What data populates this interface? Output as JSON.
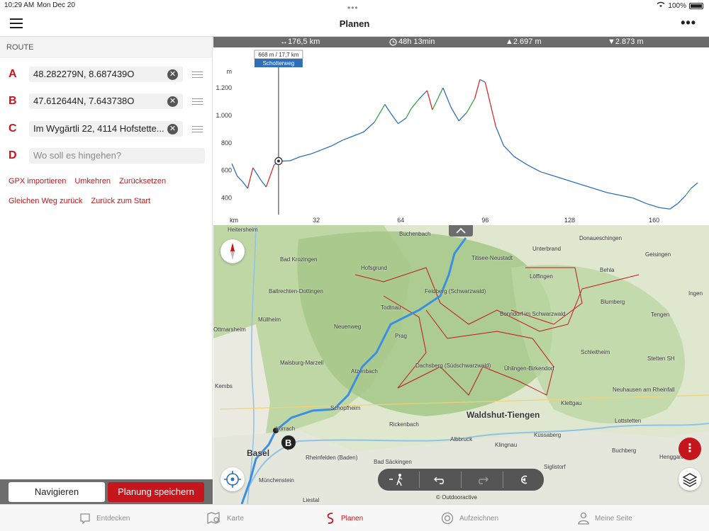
{
  "status": {
    "time": "10:29 AM",
    "date": "Mon Dec 20",
    "battery": "100%"
  },
  "header": {
    "title": "Planen"
  },
  "route": {
    "header": "ROUTE",
    "waypoints": [
      {
        "letter": "A",
        "value": "48.282279N, 8.687439O"
      },
      {
        "letter": "B",
        "value": "47.612644N, 7.643738O"
      },
      {
        "letter": "C",
        "value": "Im Wygärtli 22, 4114 Hofstette..."
      },
      {
        "letter": "D",
        "placeholder": "Wo soll es hingehen?"
      }
    ],
    "actions_row1": [
      "GPX importieren",
      "Umkehren",
      "Zurücksetzen"
    ],
    "actions_row2": [
      "Gleichen Weg zurück",
      "Zurück zum Start"
    ]
  },
  "buttons": {
    "navigate": "Navigieren",
    "save": "Planung speichern"
  },
  "stats": {
    "distance": "↔176,5 km",
    "duration": "48h 13min",
    "ascent": "▲2.697 m",
    "descent": "▼2.873 m"
  },
  "chart_data": {
    "type": "line",
    "title": "",
    "xlabel": "km",
    "ylabel": "m",
    "xlim": [
      0,
      176.5
    ],
    "ylim": [
      280,
      1380
    ],
    "x_ticks": [
      32,
      64,
      96,
      128,
      160
    ],
    "y_ticks": [
      400,
      600,
      800,
      "1.000",
      "1.200"
    ],
    "y_tick_values": [
      400,
      600,
      800,
      1000,
      1200
    ],
    "cursor": {
      "km": 17.7,
      "elevation": 668,
      "label": "668 m / 17,7 km",
      "surface": "Schotterweg"
    },
    "points": [
      [
        0,
        650
      ],
      [
        2,
        560
      ],
      [
        4,
        520
      ],
      [
        6,
        470
      ],
      [
        8,
        620
      ],
      [
        11,
        530
      ],
      [
        13,
        480
      ],
      [
        16,
        640
      ],
      [
        18,
        668
      ],
      [
        22,
        670
      ],
      [
        26,
        700
      ],
      [
        30,
        720
      ],
      [
        34,
        750
      ],
      [
        38,
        780
      ],
      [
        42,
        820
      ],
      [
        46,
        850
      ],
      [
        50,
        880
      ],
      [
        54,
        950
      ],
      [
        58,
        1080
      ],
      [
        60,
        1020
      ],
      [
        63,
        940
      ],
      [
        66,
        980
      ],
      [
        68,
        1050
      ],
      [
        71,
        1120
      ],
      [
        74,
        1180
      ],
      [
        76,
        1040
      ],
      [
        80,
        1200
      ],
      [
        83,
        1060
      ],
      [
        86,
        960
      ],
      [
        89,
        1020
      ],
      [
        92,
        1120
      ],
      [
        94,
        1260
      ],
      [
        96,
        1240
      ],
      [
        98,
        1080
      ],
      [
        100,
        920
      ],
      [
        103,
        780
      ],
      [
        107,
        700
      ],
      [
        112,
        640
      ],
      [
        117,
        590
      ],
      [
        122,
        560
      ],
      [
        127,
        530
      ],
      [
        132,
        500
      ],
      [
        137,
        470
      ],
      [
        142,
        440
      ],
      [
        147,
        420
      ],
      [
        152,
        400
      ],
      [
        157,
        360
      ],
      [
        162,
        330
      ],
      [
        166,
        320
      ],
      [
        169,
        360
      ],
      [
        172,
        420
      ],
      [
        174,
        470
      ],
      [
        176.5,
        510
      ]
    ]
  },
  "map": {
    "places": [
      "Heitersheim",
      "Buchenbach",
      "Donaueschingen",
      "Bad Krozingen",
      "Titisee-Neustadt",
      "Unterbrand",
      "Hofsgrund",
      "Löffingen",
      "Behla",
      "Geisingen",
      "Ballrechten-Dottingen",
      "Feldberg (Schwarzwald)",
      "Todtnau",
      "Bonndorf im Schwarzwald",
      "Blumberg",
      "Tengen",
      "Müllheim",
      "Neuenweg",
      "Prag",
      "Schleitheim",
      "Stetten SH",
      "Malsburg-Marzell",
      "Dachsberg (Südschwarzwald)",
      "Ühlingen-Birkendorf",
      "Atzenbach",
      "Neuhausen am Rheinfall",
      "Kembs",
      "Schopfheim",
      "Klettgau",
      "Waldshut-Tiengen",
      "Lottstetten",
      "Rickenbach",
      "Küssaberg",
      "Basel",
      "Albbruck",
      "Klingnau",
      "Buchberg",
      "Rheinfelden (Baden)",
      "Bad Säckingen",
      "Henggart",
      "Münchenstein",
      "Siglistorf",
      "Liestal",
      "Lörrach",
      "Ottmarsheim",
      "Ingen"
    ],
    "attribution": "© Outdooractive",
    "pin_label": "B"
  },
  "tabs": [
    {
      "label": "Entdecken",
      "icon": "chat-bubble-icon"
    },
    {
      "label": "Karte",
      "icon": "map-icon"
    },
    {
      "label": "Planen",
      "icon": "route-icon"
    },
    {
      "label": "Aufzeichnen",
      "icon": "record-icon"
    },
    {
      "label": "Meine Seite",
      "icon": "person-icon"
    }
  ],
  "colors": {
    "accent": "#c4161c",
    "profile_blue": "#2f6fb8",
    "profile_green": "#3aa34a",
    "profile_red": "#d42b2b",
    "route_blue": "#3b8fe0"
  }
}
